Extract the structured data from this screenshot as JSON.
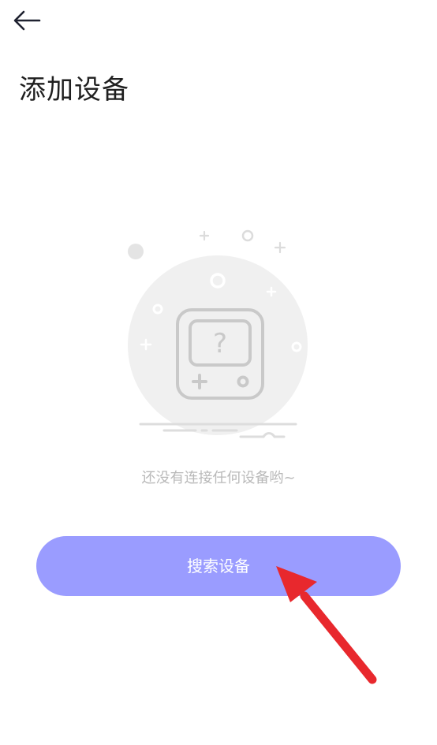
{
  "header": {
    "back_icon": "arrow-left-icon",
    "title": "添加设备"
  },
  "empty_state": {
    "illustration_icon": "device-question-icon",
    "message": "还没有连接任何设备哟~"
  },
  "actions": {
    "search_label": "搜索设备"
  },
  "colors": {
    "button_bg": "#9a9cff",
    "annotation_arrow": "#e8282d"
  }
}
